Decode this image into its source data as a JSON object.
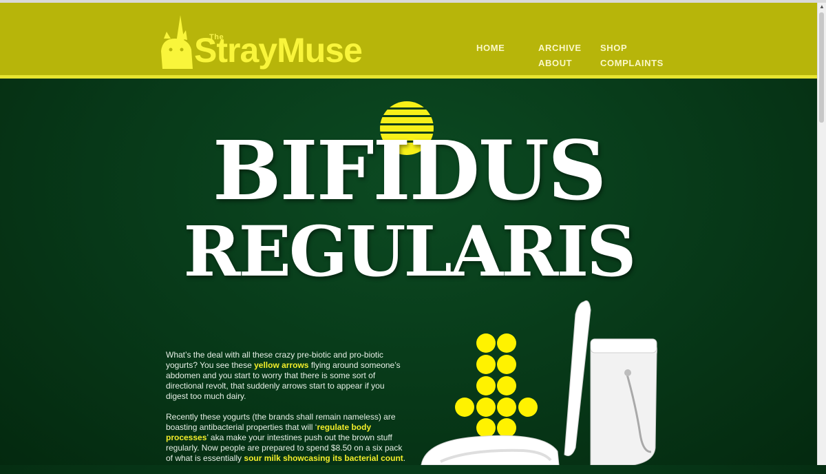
{
  "site": {
    "logo_small": "The",
    "logo_text": "StrayMuse"
  },
  "nav": [
    {
      "label": "HOME"
    },
    {
      "label": "ARCHIVE"
    },
    {
      "label": "SHOP"
    },
    {
      "label": "ABOUT"
    },
    {
      "label": "COMPLAINTS"
    }
  ],
  "hero": {
    "title_line1": "Bifidus",
    "title_line2": "Regularis"
  },
  "article": {
    "p1": [
      {
        "text": "What’s the deal with all these crazy pre-biotic and pro-biotic yogurts? You see these ",
        "hl": false
      },
      {
        "text": "yellow arrows",
        "hl": true
      },
      {
        "text": " flying around someone’s abdomen and you start to worry that there is some sort of directional revolt, that suddenly arrows start to appear if you digest too much dairy.",
        "hl": false
      }
    ],
    "p2": [
      {
        "text": "Recently these yogurts (the brands shall remain nameless) are boasting antibacterial properties that will ‘",
        "hl": false
      },
      {
        "text": "regulate body processes",
        "hl": true
      },
      {
        "text": "’ aka make your intestines push out the brown stuff regularly. Now people are prepared to spend $8.50 on a six pack of what is essentially ",
        "hl": false
      },
      {
        "text": "sour milk showcasing its bacterial count",
        "hl": true
      },
      {
        "text": ".",
        "hl": false
      }
    ]
  },
  "colors": {
    "header_bg": "#b7b50a",
    "accent_yellow": "#f9f53b",
    "page_green": "#073818"
  },
  "icons": {
    "logo": "unicorn-cat-icon",
    "sun": "striped-sun-icon",
    "arrow": "dotted-down-arrow-icon",
    "toilet": "toilet-icon"
  }
}
